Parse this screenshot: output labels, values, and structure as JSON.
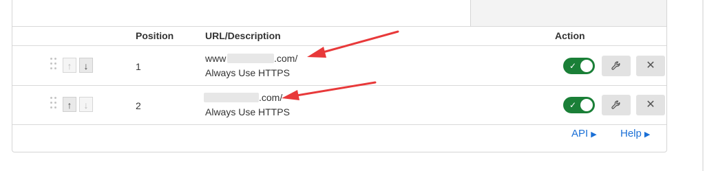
{
  "table": {
    "headers": {
      "position": "Position",
      "url": "URL/Description",
      "action": "Action"
    },
    "rows": [
      {
        "position": "1",
        "url_prefix": "www",
        "url_suffix": ".com/",
        "description": "Always Use HTTPS",
        "enabled": true
      },
      {
        "position": "2",
        "url_prefix": "",
        "url_suffix": ".com/",
        "description": "Always Use HTTPS",
        "enabled": true
      }
    ]
  },
  "icons": {
    "drag": "drag-handle-icon",
    "up": "arrow-up-icon",
    "down": "arrow-down-icon",
    "edit": "wrench-icon",
    "delete": "close-icon",
    "toggle_check": "check-icon"
  },
  "glyphs": {
    "up": "↑",
    "down": "↓",
    "check": "✓",
    "close": "✕",
    "tri": "▶"
  },
  "footer": {
    "api_label": "API",
    "help_label": "Help"
  },
  "colors": {
    "toggle_on": "#1a7f37",
    "link": "#1a6fd6",
    "annotation_arrow": "#e8393a"
  }
}
